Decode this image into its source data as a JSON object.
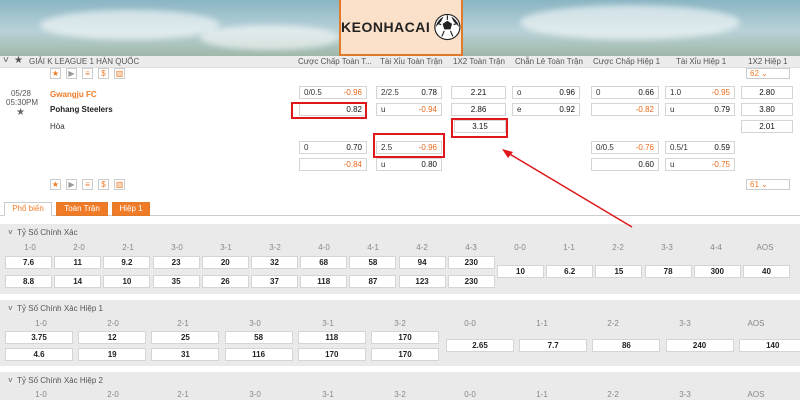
{
  "logo": {
    "text": "KEONHACAI"
  },
  "league_header": {
    "title": "GIẢI K LEAGUE 1 HÀN QUỐC",
    "columns": [
      "Cược Chấp Toàn T...",
      "Tài Xỉu Toàn Trận",
      "1X2 Toàn Trận",
      "Chẵn Lẻ Toàn Trận",
      "Cược Chấp Hiệp 1",
      "Tài Xỉu Hiệp 1",
      "1X2 Hiệp 1"
    ]
  },
  "toolbar_top": {
    "count": "62"
  },
  "match": {
    "date": "05/28",
    "time": "05:30PM",
    "home": "Gwangju FC",
    "away": "Pohang Steelers",
    "draw": "Hòa",
    "row1": {
      "hcap_line": "0/0.5",
      "hcap_home": "-0.96",
      "hcap_away": "0.82",
      "ou_line": "2/2.5",
      "ou_over": "0.78",
      "ou_under_label": "u",
      "ou_under": "-0.94",
      "x12_home": "2.21",
      "x12_away": "2.86",
      "x12_draw": "3.15",
      "oe_odd_label": "o",
      "oe_odd": "0.96",
      "oe_even_label": "e",
      "oe_even": "0.92",
      "h1_hcap_line": "0",
      "h1_hcap_home": "0.66",
      "h1_hcap_away": "-0.82",
      "h1_ou_line": "1.0",
      "h1_ou_over": "-0.95",
      "h1_ou_under_label": "u",
      "h1_ou_under": "0.79",
      "h1_x12_home": "2.80",
      "h1_x12_away": "3.80",
      "h1_x12_draw": "2.01"
    },
    "row2": {
      "hcap_line": "0",
      "hcap_home": "0.70",
      "hcap_away": "-0.84",
      "ou_line": "2.5",
      "ou_over": "-0.96",
      "ou_under_label": "u",
      "ou_under": "0.80",
      "h1_hcap_line": "0/0.5",
      "h1_hcap_home": "-0.76",
      "h1_hcap_away": "0.60",
      "h1_ou_line": "0.5/1",
      "h1_ou_over": "0.59",
      "h1_ou_under_label": "u",
      "h1_ou_under": "-0.75"
    }
  },
  "toolbar_bottom": {
    "count": "61"
  },
  "tabs": [
    "Phổ biến",
    "Toàn Trận",
    "Hiệp 1"
  ],
  "sections": [
    {
      "title": "Tỷ Số Chính Xác",
      "headers": [
        "1-0",
        "2-0",
        "2-1",
        "3-0",
        "3-1",
        "3-2",
        "4-0",
        "4-1",
        "4-2",
        "4-3",
        "0-0",
        "1-1",
        "2-2",
        "3-3",
        "4-4",
        "AOS"
      ],
      "row_home": [
        "7.6",
        "11",
        "9.2",
        "23",
        "20",
        "32",
        "68",
        "58",
        "94",
        "230"
      ],
      "row_away": [
        "8.8",
        "14",
        "10",
        "35",
        "26",
        "37",
        "118",
        "87",
        "123",
        "230"
      ],
      "row_draw": [
        "10",
        "6.2",
        "15",
        "78",
        "300",
        "40"
      ]
    },
    {
      "title": "Tỷ Số Chính Xác Hiệp 1",
      "headers": [
        "1-0",
        "2-0",
        "2-1",
        "3-0",
        "3-1",
        "3-2",
        "0-0",
        "1-1",
        "2-2",
        "3-3",
        "AOS"
      ],
      "row_home": [
        "3.75",
        "12",
        "25",
        "58",
        "118",
        "170"
      ],
      "row_away": [
        "4.6",
        "19",
        "31",
        "116",
        "170",
        "170"
      ],
      "row_draw": [
        "2.65",
        "7.7",
        "86",
        "240",
        "140"
      ]
    },
    {
      "title": "Tỷ Số Chính Xác Hiệp 2",
      "headers": [
        "1-0",
        "2-0",
        "2-1",
        "3-0",
        "3-1",
        "3-2",
        "0-0",
        "1-1",
        "2-2",
        "3-3",
        "AOS"
      ]
    }
  ],
  "colors": {
    "accent": "#f07b27",
    "highlight": "#e0181e",
    "negative": "#e96a1c"
  },
  "icons": [
    "star-icon",
    "play-icon",
    "list-icon",
    "dollar-icon",
    "chart-icon",
    "chevron-down-icon",
    "soccer-ball-icon",
    "arrow-pointer"
  ]
}
